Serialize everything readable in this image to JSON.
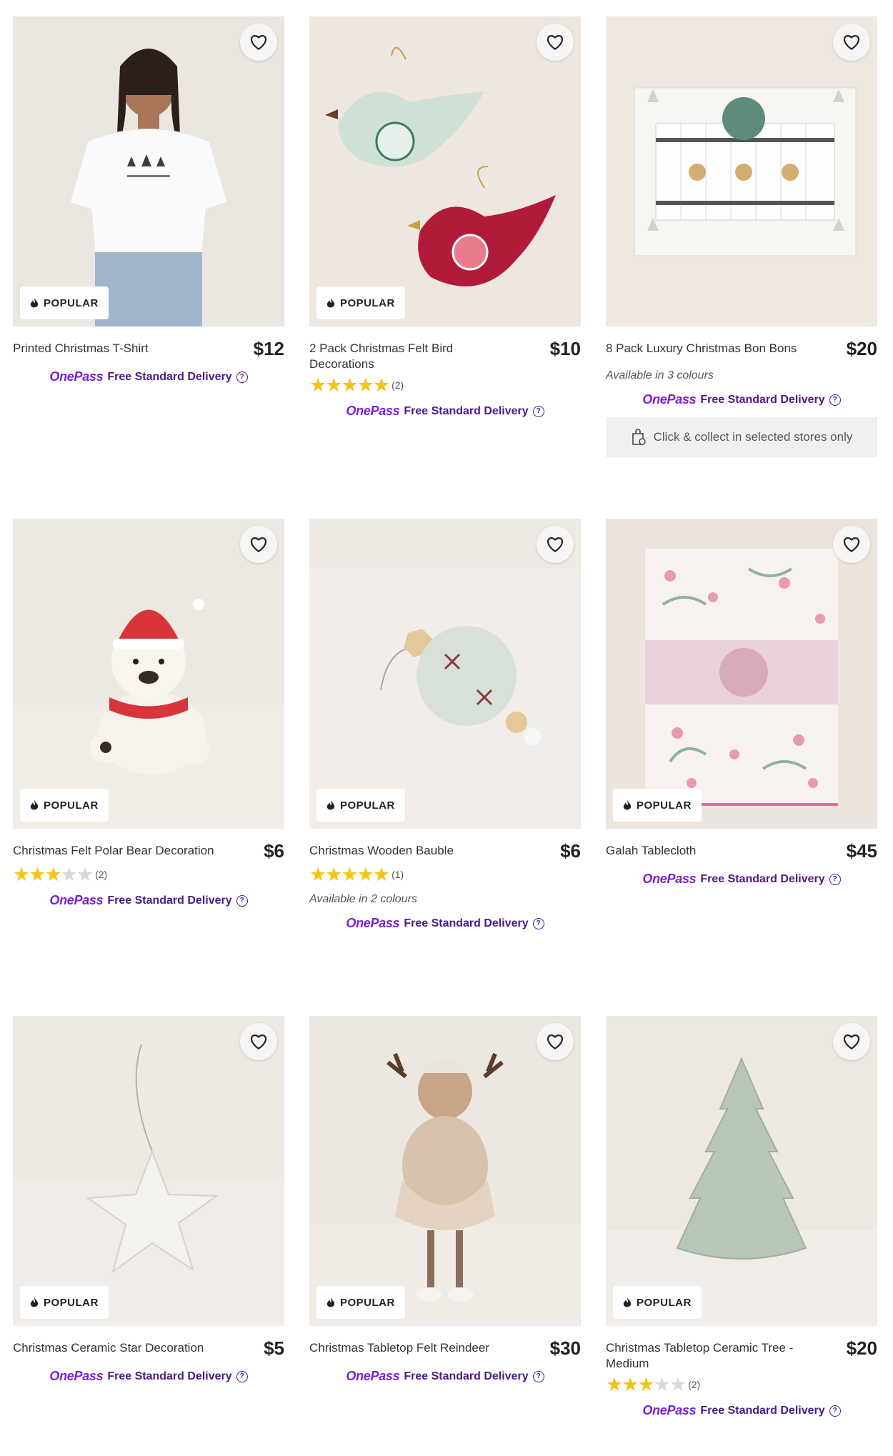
{
  "badge_label": "POPULAR",
  "onepass_label": "OnePass",
  "free_delivery_label": "Free Standard Delivery",
  "help_glyph": "?",
  "colors": {
    "onepass": "#7a1fd8",
    "delivery": "#4b1a8a",
    "star": "#f1c419",
    "image_bg": "#efe8e2"
  },
  "products": [
    {
      "name": "Printed Christmas T-Shirt",
      "price": "$12"
    },
    {
      "name": "2 Pack Christmas Felt Bird Decorations",
      "price": "$10",
      "rating": 5,
      "reviews": "(2)"
    },
    {
      "name": "8 Pack Luxury Christmas Bon Bons",
      "price": "$20",
      "colours": "Available in 3 colours",
      "click_collect": "Click & collect in selected stores only"
    },
    {
      "name": "Christmas Felt Polar Bear Decoration",
      "price": "$6",
      "rating": 3,
      "reviews": "(2)"
    },
    {
      "name": "Christmas Wooden Bauble",
      "price": "$6",
      "rating": 5,
      "reviews": "(1)",
      "colours": "Available in 2 colours"
    },
    {
      "name": "Galah Tablecloth",
      "price": "$45"
    },
    {
      "name": "Christmas Ceramic Star Decoration",
      "price": "$5"
    },
    {
      "name": "Christmas Tabletop Felt Reindeer",
      "price": "$30"
    },
    {
      "name": "Christmas Tabletop Ceramic Tree - Medium",
      "price": "$20",
      "rating": 3,
      "reviews": "(2)"
    }
  ]
}
